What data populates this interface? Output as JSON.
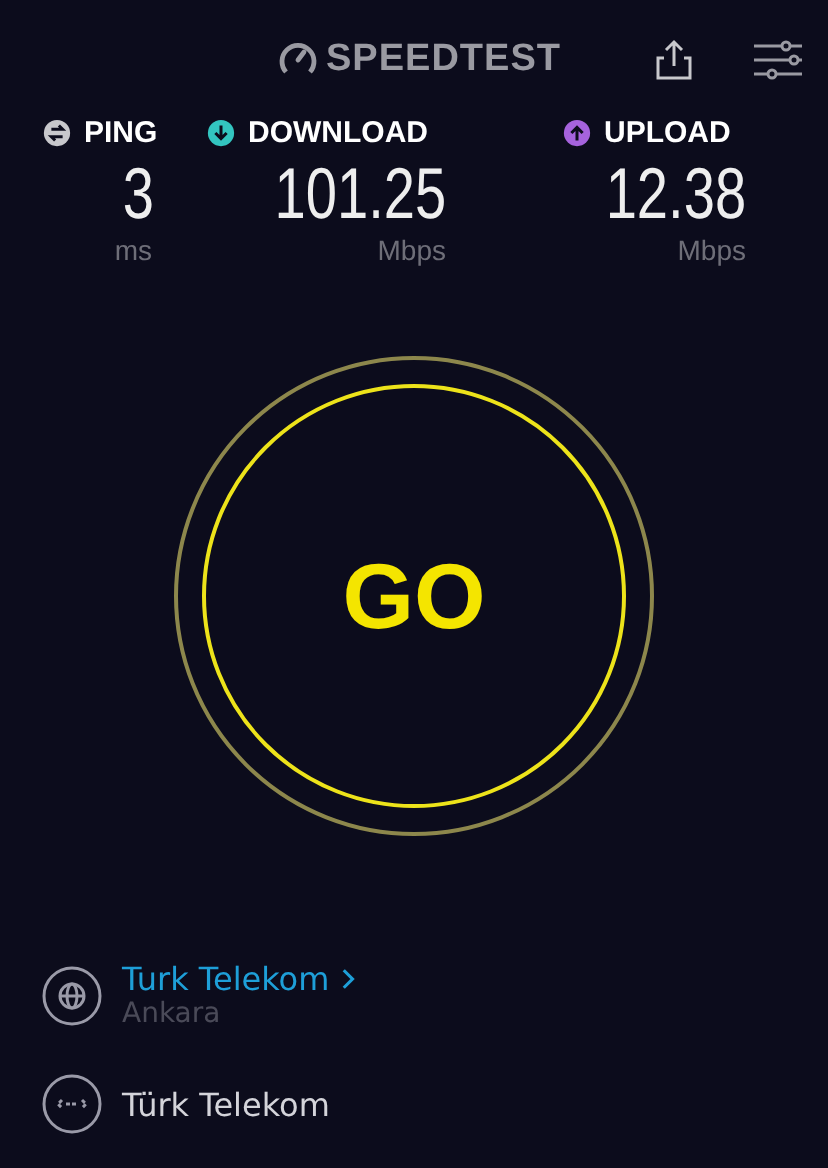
{
  "header": {
    "logo": "SPEEDTEST"
  },
  "metrics": [
    {
      "kind": "ping",
      "label": "PING",
      "value": "3",
      "unit": "ms",
      "color": "#c8c8cc"
    },
    {
      "kind": "download",
      "label": "DOWNLOAD",
      "value": "101.25",
      "unit": "Mbps",
      "color": "#33c5c0"
    },
    {
      "kind": "upload",
      "label": "UPLOAD",
      "value": "12.38",
      "unit": "Mbps",
      "color": "#a663dd"
    }
  ],
  "go_button": {
    "label": "GO"
  },
  "server": {
    "name": "Turk Telekom",
    "location": "Ankara"
  },
  "isp": {
    "name": "Türk Telekom"
  }
}
